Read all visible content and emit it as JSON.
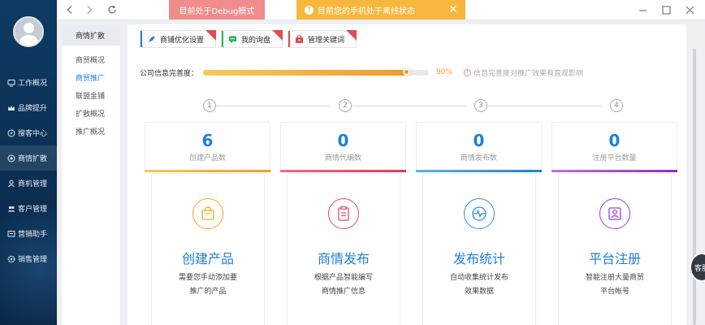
{
  "topbar": {
    "debug_label": "目前处于Debug模式",
    "offline_label": "目前您的手机处于离线状态"
  },
  "sidebar": {
    "items": [
      {
        "label": "工作概况",
        "icon": "monitor-icon"
      },
      {
        "label": "品牌提升",
        "icon": "crown-icon"
      },
      {
        "label": "搜客中心",
        "icon": "compass-icon"
      },
      {
        "label": "商情扩散",
        "icon": "broadcast-icon"
      },
      {
        "label": "商机管理",
        "icon": "user-icon"
      },
      {
        "label": "客户管理",
        "icon": "users-icon"
      },
      {
        "label": "营销助手",
        "icon": "megaphone-icon"
      },
      {
        "label": "销售管理",
        "icon": "gear-icon"
      }
    ],
    "active_index": 3
  },
  "submenu": {
    "title": "商情扩散",
    "items": [
      "商贸概况",
      "商贸推广",
      "联盟金铺",
      "扩散概况",
      "推广概况"
    ],
    "active_index": 1
  },
  "quicklinks": [
    {
      "label": "商铺优化设置",
      "color": "#1e7fd8",
      "icon": "rocket-icon"
    },
    {
      "label": "我的询盘",
      "color": "#2db55d",
      "icon": "chat-icon"
    },
    {
      "label": "管理关键词",
      "color": "#e24c4c",
      "icon": "briefcase-icon"
    }
  ],
  "progress": {
    "label": "公司信息完善度：",
    "percent": 90,
    "percent_text": "90%",
    "tip": "信息完善度对推广效果有直观影响"
  },
  "steps": [
    "1",
    "2",
    "3",
    "4"
  ],
  "stats": [
    {
      "value": "6",
      "label": "创建产品数",
      "color": "#f5a623"
    },
    {
      "value": "0",
      "label": "商情代编数",
      "color": "#e24c6a"
    },
    {
      "value": "0",
      "label": "商情发布数",
      "color": "#2f8fe0"
    },
    {
      "value": "0",
      "label": "注册平台数量",
      "color": "#9b3fd1"
    }
  ],
  "features": [
    {
      "title": "创建产品",
      "desc1": "需要您手动添加要",
      "desc2": "推广的产品",
      "color": "#f5a623",
      "icon": "package-icon"
    },
    {
      "title": "商情发布",
      "desc1": "根据产品智能编写",
      "desc2": "商情推广信息",
      "color": "#e24c6a",
      "icon": "document-icon"
    },
    {
      "title": "发布统计",
      "desc1": "自动收集统计发布",
      "desc2": "效果数据",
      "color": "#2f8fe0",
      "icon": "pulse-icon"
    },
    {
      "title": "平台注册",
      "desc1": "智能注册大量商贸",
      "desc2": "平台帐号",
      "color": "#9b3fd1",
      "icon": "id-card-icon"
    }
  ],
  "floating": {
    "label": "客服"
  }
}
